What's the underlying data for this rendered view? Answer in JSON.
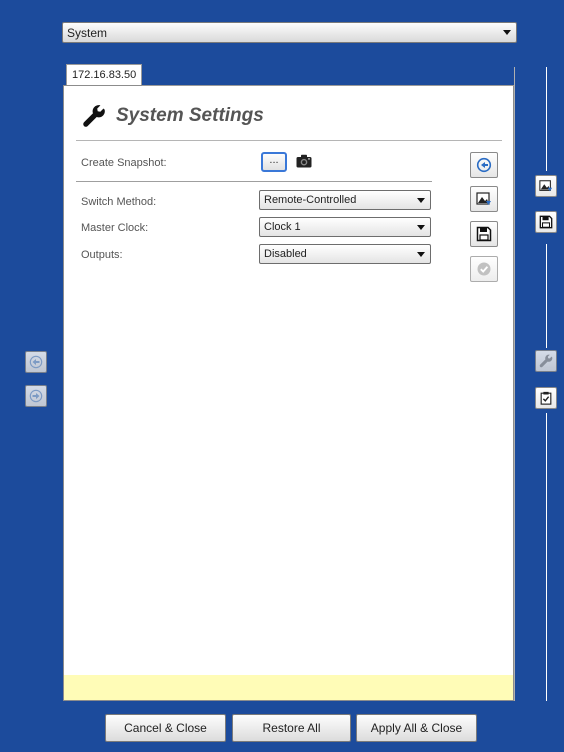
{
  "system_select": {
    "value": "System"
  },
  "tab": {
    "label": "172.16.83.50"
  },
  "panel": {
    "title": "System Settings",
    "snapshot": {
      "label": "Create Snapshot:",
      "browse_label": "..."
    },
    "rows": [
      {
        "label": "Switch Method:",
        "value": "Remote-Controlled"
      },
      {
        "label": "Master Clock:",
        "value": "Clock 1"
      },
      {
        "label": "Outputs:",
        "value": "Disabled"
      }
    ]
  },
  "buttons": {
    "cancel": "Cancel & Close",
    "restore": "Restore All",
    "apply": "Apply All & Close"
  },
  "icons": {
    "panel_tools": [
      "reset-icon",
      "load-image-icon",
      "save-icon",
      "check-icon"
    ],
    "right_side": [
      "load-image-icon",
      "save-icon",
      "wrench-icon",
      "clipboard-icon"
    ],
    "left_side": [
      "back-arrow-icon",
      "forward-arrow-icon"
    ]
  },
  "colors": {
    "background": "#1c4b9c",
    "accent": "#3a78d8",
    "notice": "#fffcb7"
  }
}
